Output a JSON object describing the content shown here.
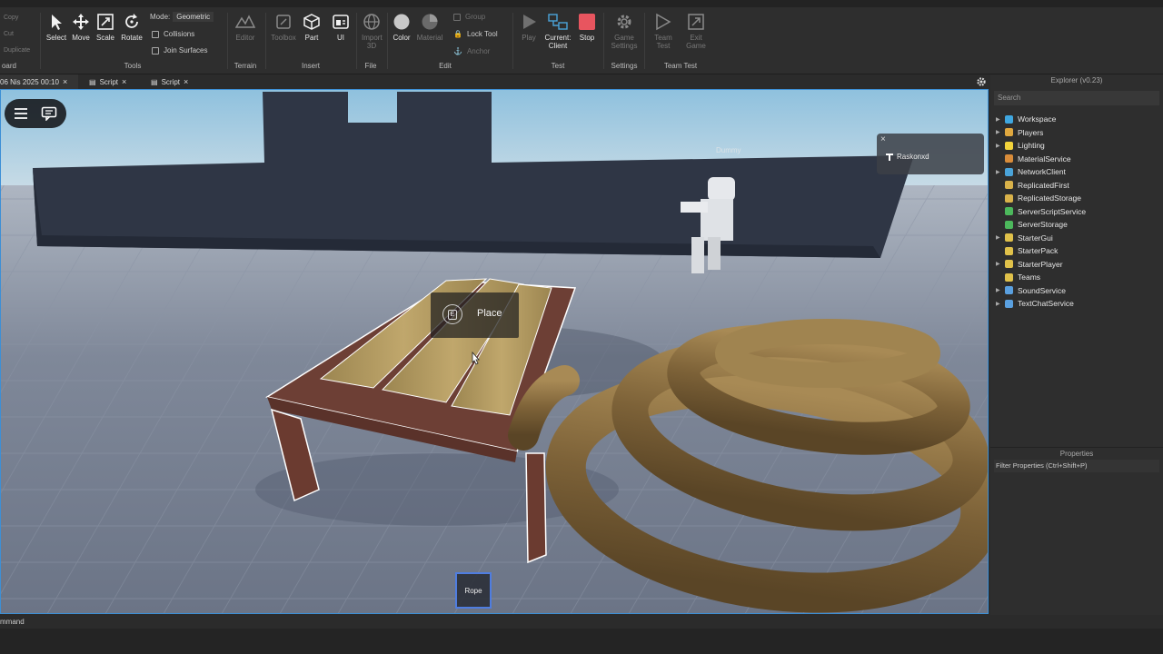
{
  "ribbon": {
    "clipboard": {
      "copy": "Copy",
      "cut": "Cut",
      "duplicate": "Duplicate",
      "group_label": "oard"
    },
    "tools": {
      "group_label": "Tools",
      "select": "Select",
      "move": "Move",
      "scale": "Scale",
      "rotate": "Rotate",
      "mode_label": "Mode:",
      "mode_value": "Geometric",
      "collisions": "Collisions",
      "join_surfaces": "Join Surfaces"
    },
    "terrain": {
      "group_label": "Terrain",
      "editor": "Editor"
    },
    "insert": {
      "group_label": "Insert",
      "toolbox": "Toolbox",
      "part": "Part",
      "ui": "UI"
    },
    "file": {
      "group_label": "File",
      "import_3d": "Import 3D"
    },
    "edit": {
      "group_label": "Edit",
      "color": "Color",
      "material": "Material",
      "group": "Group",
      "lock_tool": "Lock Tool",
      "anchor": "Anchor"
    },
    "test": {
      "group_label": "Test",
      "play": "Play",
      "current_client": "Current: Client",
      "stop": "Stop"
    },
    "settings": {
      "group_label": "Settings",
      "game_settings": "Game Settings"
    },
    "team_test": {
      "group_label": "Team Test",
      "team_test": "Team Test",
      "exit_game": "Exit Game"
    }
  },
  "tabs": [
    {
      "label": "06 Nis 2025 00:10",
      "close": "×"
    },
    {
      "label": "Script",
      "close": "×"
    },
    {
      "label": "Script",
      "close": "×"
    }
  ],
  "viewport": {
    "dummy_label": "Dummy",
    "player_name": "Raskonxd",
    "close_glyph": "×",
    "prompt_key": "E",
    "prompt_action": "Place",
    "hotbar_item": "Rope"
  },
  "explorer": {
    "title": "Explorer (v0.23)",
    "search_placeholder": "Search",
    "items": [
      {
        "label": "Workspace",
        "color": "#3fa7e0",
        "expand": "▶"
      },
      {
        "label": "Players",
        "color": "#e0a83f",
        "expand": "▶"
      },
      {
        "label": "Lighting",
        "color": "#f2d33b",
        "expand": "▶"
      },
      {
        "label": "MaterialService",
        "color": "#d98c3a",
        "expand": ""
      },
      {
        "label": "NetworkClient",
        "color": "#4aa3d9",
        "expand": "▶"
      },
      {
        "label": "ReplicatedFirst",
        "color": "#d9b24a",
        "expand": ""
      },
      {
        "label": "ReplicatedStorage",
        "color": "#d9b24a",
        "expand": ""
      },
      {
        "label": "ServerScriptService",
        "color": "#4cb85c",
        "expand": ""
      },
      {
        "label": "ServerStorage",
        "color": "#4cb85c",
        "expand": ""
      },
      {
        "label": "StarterGui",
        "color": "#e0c14a",
        "expand": "▶"
      },
      {
        "label": "StarterPack",
        "color": "#e0c14a",
        "expand": ""
      },
      {
        "label": "StarterPlayer",
        "color": "#e0c14a",
        "expand": "▶"
      },
      {
        "label": "Teams",
        "color": "#e0c14a",
        "expand": ""
      },
      {
        "label": "SoundService",
        "color": "#5aa0e0",
        "expand": "▶"
      },
      {
        "label": "TextChatService",
        "color": "#5aa0e0",
        "expand": "▶"
      }
    ]
  },
  "properties": {
    "title": "Properties",
    "filter_placeholder": "Filter Properties (Ctrl+Shift+P)"
  },
  "command_bar": {
    "label": "mmand"
  }
}
